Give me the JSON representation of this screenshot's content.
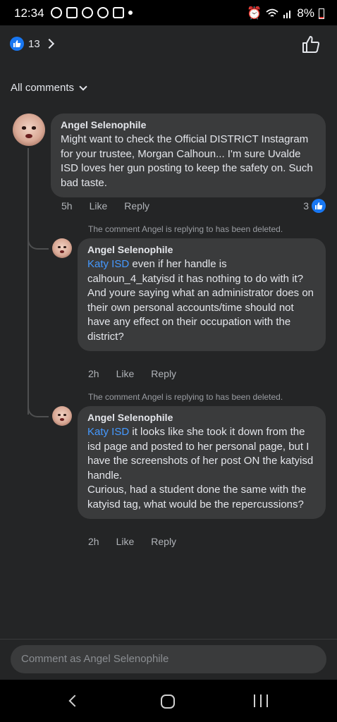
{
  "status_bar": {
    "time": "12:34",
    "battery": "8%"
  },
  "header": {
    "reaction_count": "13"
  },
  "filter": {
    "label": "All comments"
  },
  "comments": [
    {
      "author": "Angel Selenophile",
      "text": "Might want to check the Official DISTRICT Instagram for your trustee, Morgan Calhoun... I'm sure Uvalde ISD loves her gun posting to keep the safety on. Such bad taste.",
      "time": "5h",
      "like_label": "Like",
      "reply_label": "Reply",
      "likes": "3"
    }
  ],
  "replies": [
    {
      "deleted_notice": "The comment Angel is replying to has been deleted.",
      "author": "Angel Selenophile",
      "tag": "Katy ISD",
      "text": " even if her handle is calhoun_4_katyisd it has nothing to do with it?\nAnd youre saying what an administrator does on their own personal accounts/time should not have any effect on their occupation with the district?",
      "time": "2h",
      "like_label": "Like",
      "reply_label": "Reply"
    },
    {
      "deleted_notice": "The comment Angel is replying to has been deleted.",
      "author": "Angel Selenophile",
      "tag": "Katy ISD",
      "text": " it looks like she took it down from the isd page and posted to her personal page, but I have the screenshots of her post ON the katyisd handle.\nCurious, had a student done the same with the katyisd tag, what would be the repercussions?",
      "time": "2h",
      "like_label": "Like",
      "reply_label": "Reply"
    }
  ],
  "composer": {
    "placeholder": "Comment as Angel Selenophile"
  },
  "colors": {
    "background": "#242526",
    "bubble": "#3a3b3c",
    "accent": "#1877f2",
    "tag": "#4599ff"
  }
}
